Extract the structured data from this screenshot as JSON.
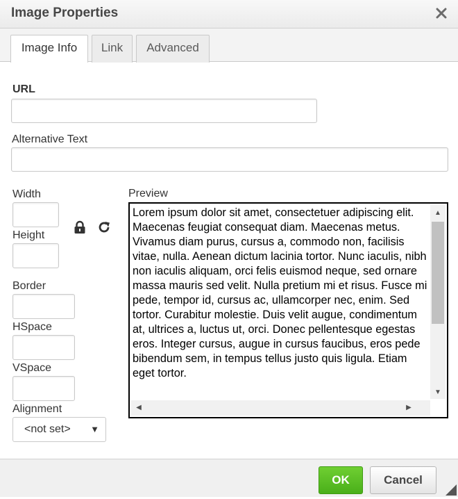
{
  "dialog": {
    "title": "Image Properties"
  },
  "tabs": [
    {
      "label": "Image Info",
      "active": true
    },
    {
      "label": "Link",
      "active": false
    },
    {
      "label": "Advanced",
      "active": false
    }
  ],
  "fields": {
    "url": {
      "label": "URL",
      "value": ""
    },
    "alt_text": {
      "label": "Alternative Text",
      "value": ""
    },
    "width": {
      "label": "Width",
      "value": ""
    },
    "height": {
      "label": "Height",
      "value": ""
    },
    "border": {
      "label": "Border",
      "value": ""
    },
    "hspace": {
      "label": "HSpace",
      "value": ""
    },
    "vspace": {
      "label": "VSpace",
      "value": ""
    },
    "alignment": {
      "label": "Alignment",
      "selected": "<not set>"
    }
  },
  "icons": {
    "lock": "lock-icon",
    "reset": "reset-size-icon",
    "close": "close-icon"
  },
  "preview": {
    "label": "Preview",
    "text": "Lorem ipsum dolor sit amet, consectetuer adipiscing elit. Maecenas feugiat consequat diam. Maecenas metus. Vivamus diam purus, cursus a, commodo non, facilisis vitae, nulla. Aenean dictum lacinia tortor. Nunc iaculis, nibh non iaculis aliquam, orci felis euismod neque, sed ornare massa mauris sed velit. Nulla pretium mi et risus. Fusce mi pede, tempor id, cursus ac, ullamcorper nec, enim. Sed tortor. Curabitur molestie. Duis velit augue, condimentum at, ultrices a, luctus ut, orci. Donec pellentesque egestas eros. Integer cursus, augue in cursus faucibus, eros pede bibendum sem, in tempus tellus justo quis ligula. Etiam eget tortor."
  },
  "footer": {
    "ok_label": "OK",
    "cancel_label": "Cancel"
  },
  "colors": {
    "ok_green": "#5cbd24",
    "title_text": "#474747"
  }
}
